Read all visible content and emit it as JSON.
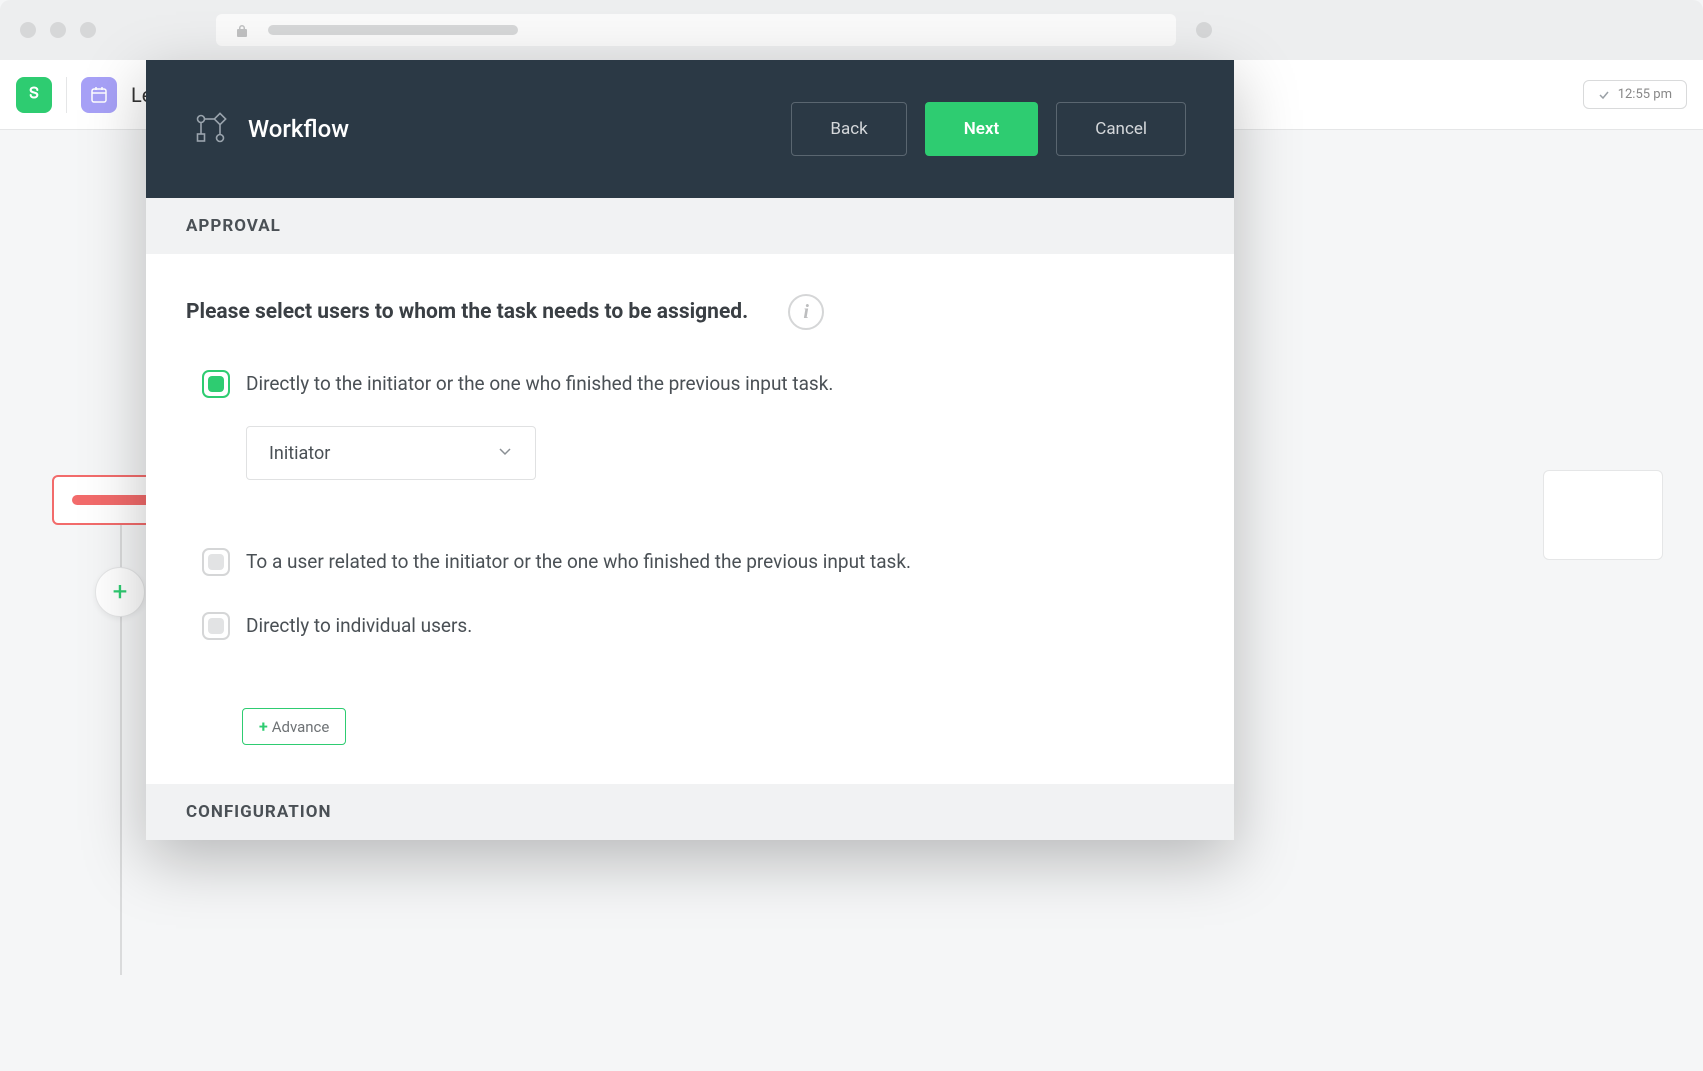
{
  "browser": {},
  "topbar": {
    "leading_text": "Le",
    "time": "12:55 pm"
  },
  "modal": {
    "title": "Workflow",
    "buttons": {
      "back": "Back",
      "next": "Next",
      "cancel": "Cancel"
    },
    "section_approval": "APPROVAL",
    "section_configuration": "CONFIGURATION",
    "prompt": "Please select users to whom the task needs to be assigned.",
    "options": [
      {
        "label": "Directly to the initiator or the one who finished the previous input task.",
        "checked": true,
        "select_value": "Initiator"
      },
      {
        "label": "To a user related to the initiator or the one who finished the previous input task.",
        "checked": false
      },
      {
        "label": "Directly to individual users.",
        "checked": false
      }
    ],
    "advance_label": "Advance"
  }
}
